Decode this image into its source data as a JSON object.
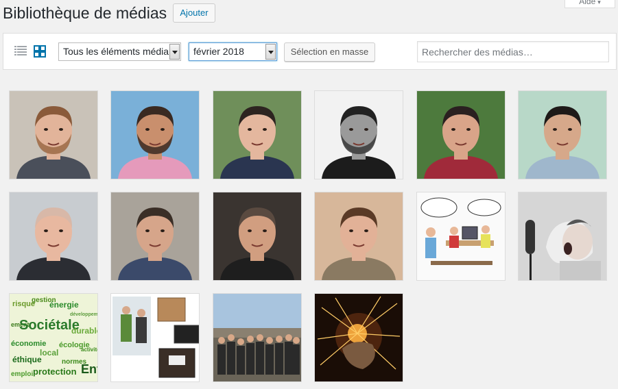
{
  "help_tab": {
    "label": "Aide"
  },
  "header": {
    "title": "Bibliothèque de médias",
    "add_label": "Ajouter"
  },
  "toolbar": {
    "type_filter": "Tous les éléments média",
    "date_filter": "février 2018",
    "bulk_label": "Sélection en masse",
    "search_placeholder": "Rechercher des médias…"
  },
  "grid": {
    "items": [
      {
        "kind": "portrait",
        "bg": "#c9c2b8",
        "skin": "#e2b49a",
        "hair": "#8a5a3a",
        "shirt": "#4a4f5a",
        "beard": "#9b6a45"
      },
      {
        "kind": "portrait",
        "bg": "#7ab0d8",
        "skin": "#c98f6d",
        "hair": "#3a2a22",
        "shirt": "#e59abb",
        "beard": "#3b2a22"
      },
      {
        "kind": "portrait",
        "bg": "#6f8f5a",
        "skin": "#e4b79e",
        "hair": "#2d2420",
        "shirt": "#2a3550",
        "beard": ""
      },
      {
        "kind": "portrait",
        "bg": "#f2f2f2",
        "skin": "#9a9a9a",
        "hair": "#222222",
        "shirt": "#1c1c1c",
        "beard": "#3a3a3a"
      },
      {
        "kind": "portrait",
        "bg": "#4d7a3d",
        "skin": "#d9a489",
        "hair": "#2a2020",
        "shirt": "#a02a3a",
        "beard": ""
      },
      {
        "kind": "portrait",
        "bg": "#b8d8c8",
        "skin": "#d6a88a",
        "hair": "#1e1a18",
        "shirt": "#9fb7cc",
        "beard": ""
      },
      {
        "kind": "portrait",
        "bg": "#c8ccd0",
        "skin": "#e8b8a0",
        "hair": "#d8b8a8",
        "shirt": "#2b2d33",
        "beard": ""
      },
      {
        "kind": "portrait",
        "bg": "#a9a39a",
        "skin": "#d6a58a",
        "hair": "#3a2e26",
        "shirt": "#3b4a6a",
        "beard": ""
      },
      {
        "kind": "portrait",
        "bg": "#3a3430",
        "skin": "#d19e80",
        "hair": "#5a4a40",
        "shirt": "#1e1e1e",
        "beard": ""
      },
      {
        "kind": "portrait",
        "bg": "#d7b79a",
        "skin": "#e2b197",
        "hair": "#5a3a26",
        "shirt": "#8a7a62",
        "beard": ""
      },
      {
        "kind": "cartoon"
      },
      {
        "kind": "shout"
      },
      {
        "kind": "wordcloud"
      },
      {
        "kind": "boxes"
      },
      {
        "kind": "group"
      },
      {
        "kind": "sparks"
      }
    ]
  }
}
